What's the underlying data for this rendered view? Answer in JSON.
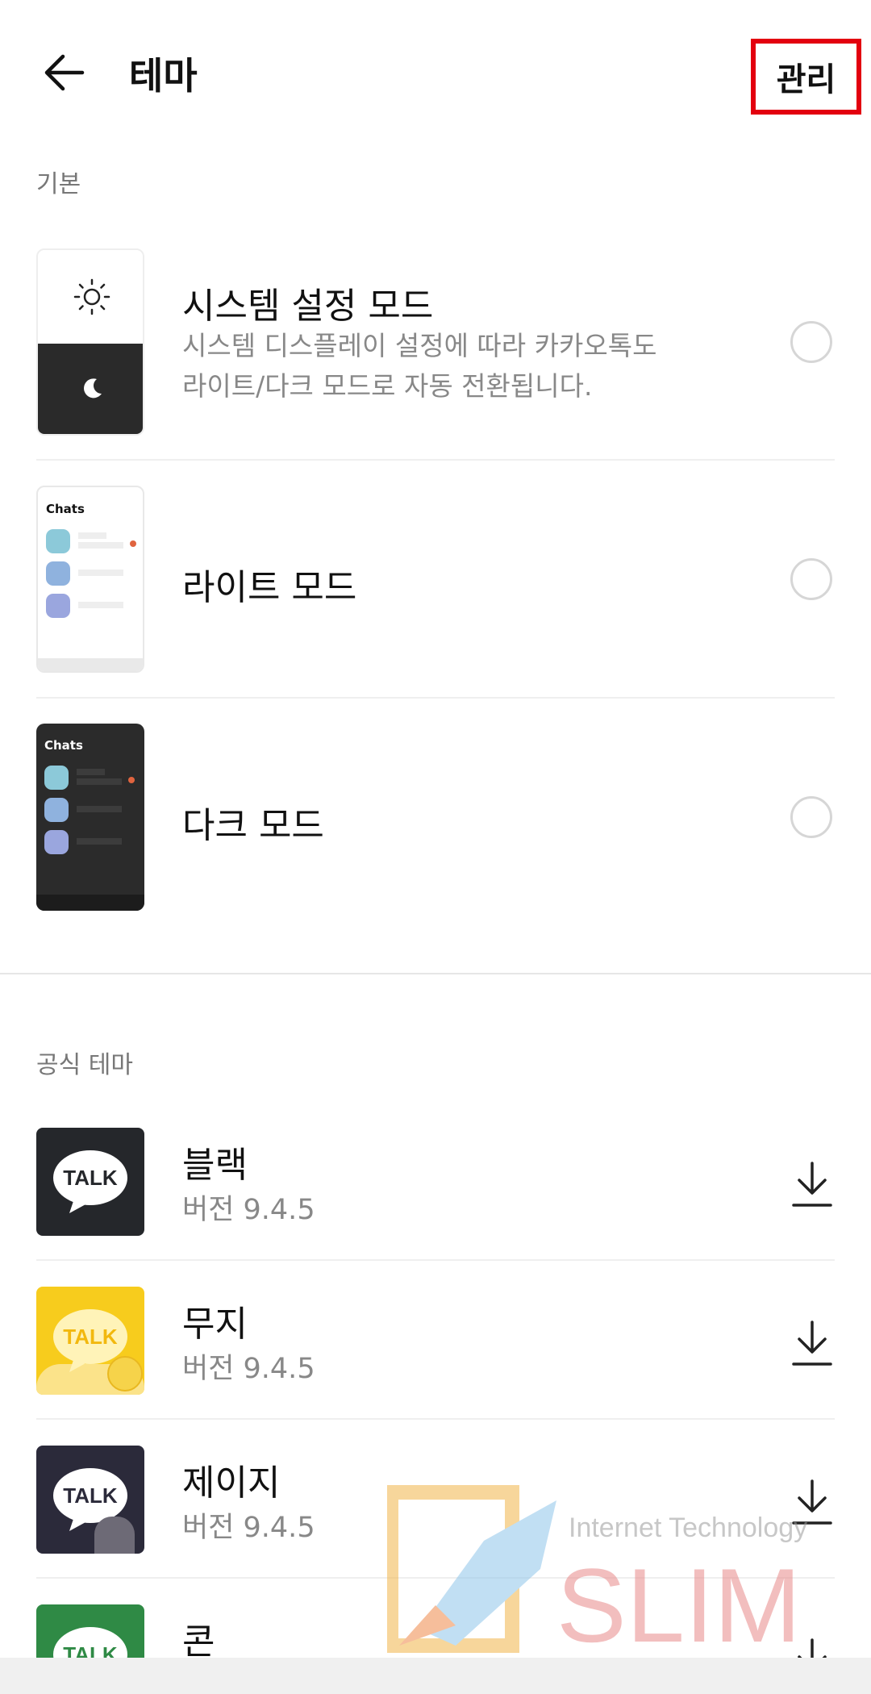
{
  "header": {
    "title": "테마",
    "manage_label": "관리"
  },
  "sections": {
    "basic": "기본",
    "official": "공식 테마"
  },
  "basic_items": [
    {
      "title": "시스템 설정 모드",
      "desc_line1": "시스템 디스플레이 설정에 따라 카카오톡도",
      "desc_line2": "라이트/다크 모드로 자동 전환됩니다."
    },
    {
      "title": "라이트 모드",
      "thumb_label": "Chats"
    },
    {
      "title": "다크 모드",
      "thumb_label": "Chats"
    }
  ],
  "themes": [
    {
      "title": "블랙",
      "version": "버전 9.4.5",
      "icon_text": "TALK",
      "bg": "#25272b"
    },
    {
      "title": "무지",
      "version": "버전 9.4.5",
      "icon_text": "TALK",
      "bg": "#f7cc1d"
    },
    {
      "title": "제이지",
      "version": "버전 9.4.5",
      "icon_text": "TALK",
      "bg": "#2b2a3a"
    },
    {
      "title": "콘",
      "version": "",
      "icon_text": "TALK",
      "bg": "#2f8a45"
    }
  ],
  "watermark": {
    "line1": "Internet Technology",
    "line2": "SLIM"
  },
  "colors": {
    "highlight": "#e3000f",
    "divider": "#efefef",
    "dot": "#e0643f"
  }
}
